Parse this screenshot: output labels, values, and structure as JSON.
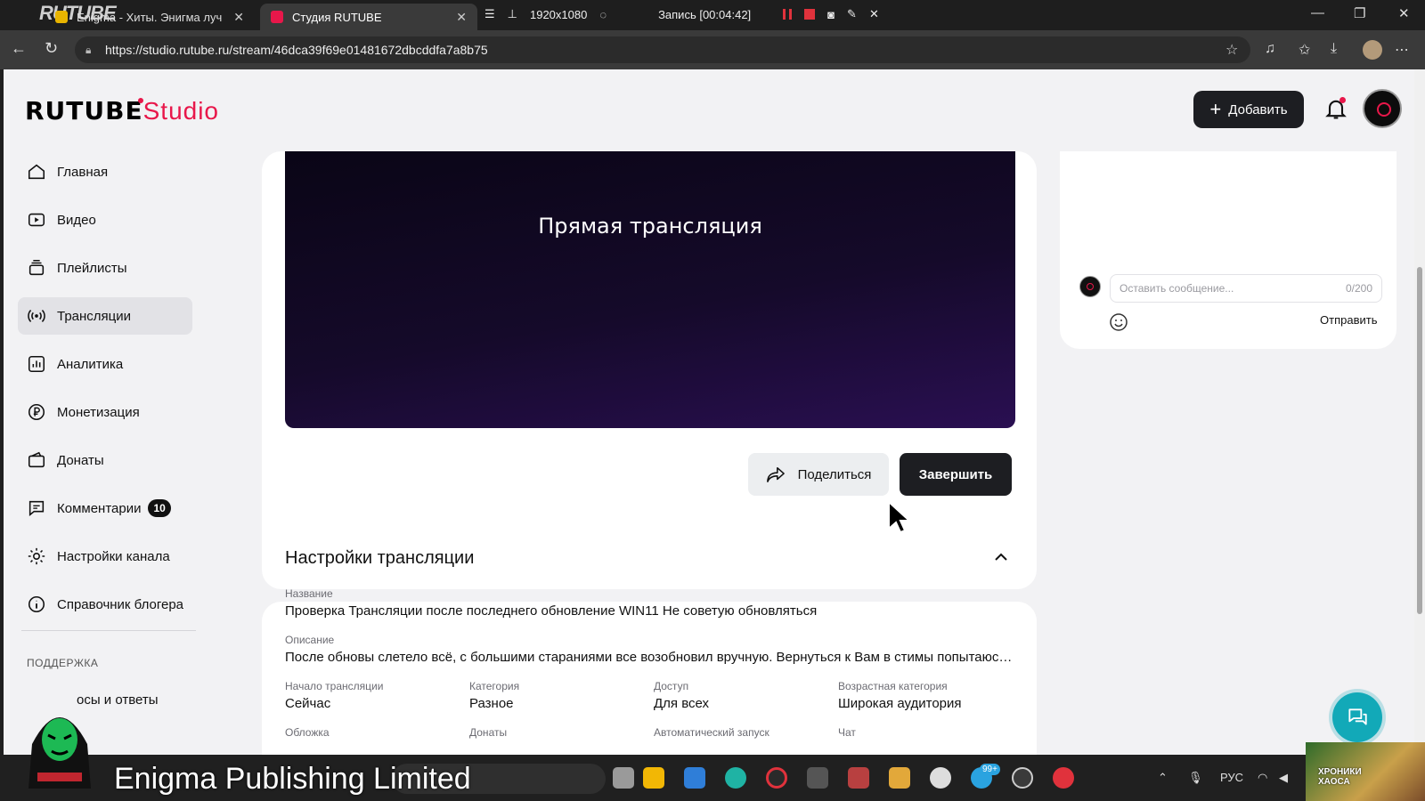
{
  "browser": {
    "tabs": [
      {
        "title": "Enigma - Хиты. Энигма луч",
        "close": "✕"
      },
      {
        "title": "Студия RUTUBE",
        "close": "✕"
      }
    ],
    "url": "https://studio.rutube.ru/stream/46dca39f69e01481672dbcddfa7a8b75",
    "recorder": {
      "resolution": "1920x1080",
      "status": "Запись [00:04:42]"
    },
    "overlay_logo": "RUTUBE"
  },
  "header": {
    "logo_main": "RUTUBE",
    "logo_sub": "Studio",
    "add_label": "Добавить"
  },
  "sidebar": {
    "items": [
      {
        "label": "Главная",
        "icon": "home-icon"
      },
      {
        "label": "Видео",
        "icon": "video-icon"
      },
      {
        "label": "Плейлисты",
        "icon": "playlist-icon"
      },
      {
        "label": "Трансляции",
        "icon": "broadcast-icon",
        "active": true
      },
      {
        "label": "Аналитика",
        "icon": "analytics-icon"
      },
      {
        "label": "Монетизация",
        "icon": "ruble-icon"
      },
      {
        "label": "Донаты",
        "icon": "wallet-icon"
      },
      {
        "label": "Комментарии",
        "icon": "comment-icon",
        "badge": "10"
      },
      {
        "label": "Настройки канала",
        "icon": "gear-icon"
      },
      {
        "label": "Справочник блогера",
        "icon": "info-icon"
      }
    ],
    "support_heading": "ПОДДЕРЖКА",
    "support_item": "осы и ответы"
  },
  "player": {
    "title": "Прямая трансляция",
    "share_label": "Поделиться",
    "finish_label": "Завершить"
  },
  "chat": {
    "placeholder": "Оставить сообщение...",
    "counter": "0/200",
    "send_label": "Отправить"
  },
  "settings": {
    "title": "Настройки трансляции",
    "name_label": "Название",
    "name_value": "Проверка Трансляции после последнего обновление WIN11 Не советую обновляться",
    "desc_label": "Описание",
    "desc_value": "После обновы слетело всё, с большими стараниями все возобновил вручную. Вернуться к Вам в стимы попытаюсь с...",
    "fields": [
      {
        "label": "Начало трансляции",
        "value": "Сейчас"
      },
      {
        "label": "Категория",
        "value": "Разное"
      },
      {
        "label": "Доступ",
        "value": "Для всех"
      },
      {
        "label": "Возрастная категория",
        "value": "Широкая аудитория"
      }
    ],
    "fields2": [
      "Обложка",
      "Донаты",
      "Автоматический запуск",
      "Чат"
    ]
  },
  "overlays": {
    "bottom_text": "Enigma Publishing Limited",
    "corner_text": "ХРОНИКИ ХАОСА"
  },
  "taskbar": {
    "lang": "РУС",
    "telegram_badge": "99+"
  },
  "colors": {
    "accent": "#e8174a",
    "dark_button": "#1d1e22",
    "help": "#12a9b8"
  }
}
